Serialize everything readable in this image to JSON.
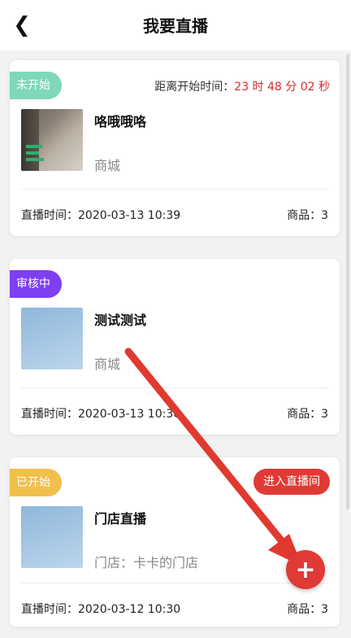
{
  "header": {
    "title": "我要直播",
    "back_icon": "chevron-left-icon"
  },
  "items": [
    {
      "status": "未开始",
      "status_color": "#7ed8b9",
      "countdown_label": "距离开始时间：",
      "countdown_value": "23 时 48 分 02 秒",
      "title": "咯哦哦咯",
      "subtitle": "商城",
      "time_label": "直播时间：",
      "time": "2020-03-13 10:39",
      "goods_label": "商品：",
      "goods_count": "3"
    },
    {
      "status": "审核中",
      "status_color": "#7d3ff0",
      "title": "测试测试",
      "subtitle": "商城",
      "time_label": "直播时间：",
      "time": "2020-03-13 10:36",
      "goods_label": "商品：",
      "goods_count": "3"
    },
    {
      "status": "已开始",
      "status_color": "#f1bf4b",
      "enter_label": "进入直播间",
      "title": "门店直播",
      "subtitle": "门店：卡卡的门店",
      "time_label": "直播时间：",
      "time": "2020-03-12 10:30",
      "goods_label": "商品：",
      "goods_count": "3"
    }
  ],
  "fab": {
    "icon": "plus-icon",
    "symbol": "+"
  },
  "colors": {
    "accent": "#e03a36",
    "countdown": "#d92a2a"
  }
}
